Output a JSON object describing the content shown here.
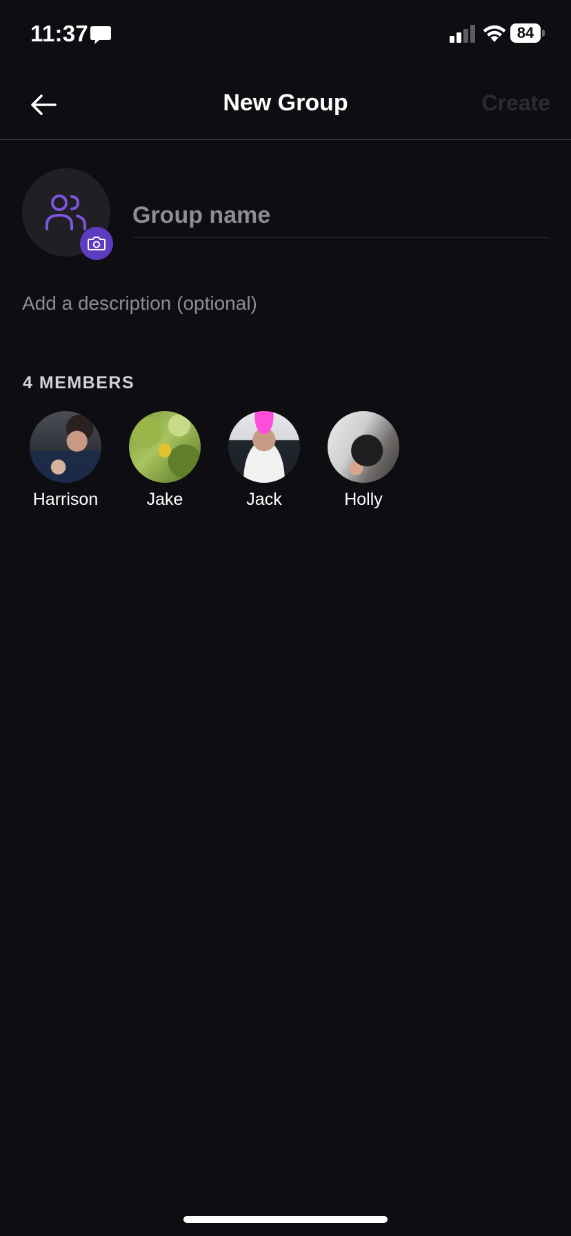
{
  "status_bar": {
    "time": "11:37",
    "battery": "84",
    "icons": [
      "message-icon",
      "signal-icon",
      "wifi-icon",
      "battery-icon"
    ]
  },
  "nav": {
    "title": "New Group",
    "create_label": "Create",
    "back_icon": "back-arrow-icon"
  },
  "group": {
    "name_placeholder": "Group name",
    "name_value": "",
    "description_placeholder": "Add a description (optional)",
    "description_value": "",
    "avatar_icon": "people-icon",
    "camera_icon": "camera-icon"
  },
  "members": {
    "heading": "4 MEMBERS",
    "items": [
      {
        "name": "Harrison"
      },
      {
        "name": "Jake"
      },
      {
        "name": "Jack"
      },
      {
        "name": "Holly"
      }
    ]
  },
  "colors": {
    "background": "#0e0d12",
    "accent": "#5d3cc2",
    "accent_icon": "#7b56df",
    "create_disabled": "#2c2b31",
    "placeholder": "#8e8d93"
  }
}
